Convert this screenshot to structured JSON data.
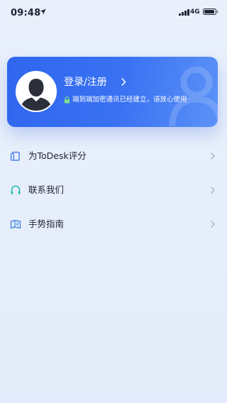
{
  "status_bar": {
    "time": "09:48",
    "network": "4G"
  },
  "profile_card": {
    "login_label": "登录/注册",
    "secure_text": "端到端加密通讯已经建立，请放心使用",
    "accent_color": "#3a72f3"
  },
  "menu": {
    "items": [
      {
        "label": "为ToDesk评分",
        "icon": "rate-icon"
      },
      {
        "label": "联系我们",
        "icon": "headset-icon"
      },
      {
        "label": "手势指南",
        "icon": "guide-book-icon"
      }
    ]
  }
}
